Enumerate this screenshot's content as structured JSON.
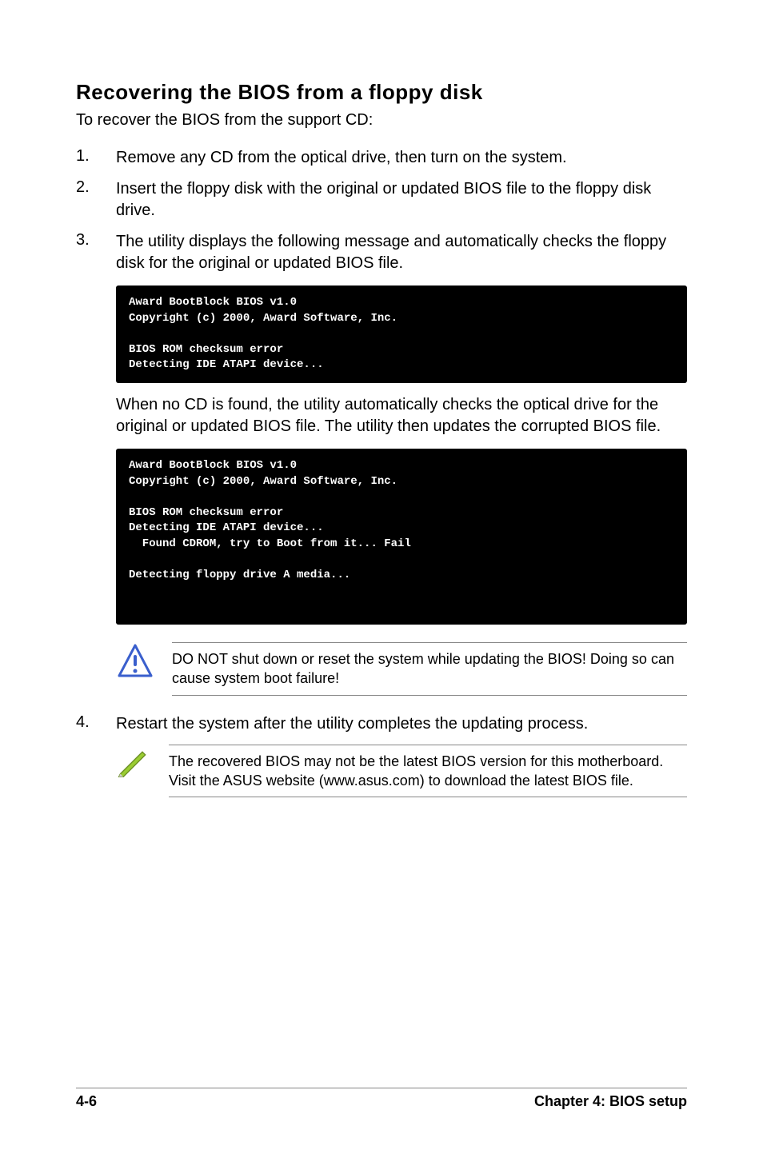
{
  "heading": "Recovering the BIOS from a floppy disk",
  "intro": "To recover the BIOS from the support CD:",
  "steps": {
    "s1": {
      "num": "1.",
      "text": "Remove any CD from the optical drive, then turn on the system."
    },
    "s2": {
      "num": "2.",
      "text": "Insert the floppy disk with the original or updated BIOS file to the floppy disk drive."
    },
    "s3": {
      "num": "3.",
      "text": "The utility displays the following message and automatically checks the floppy disk for the original or updated BIOS file."
    },
    "s4": {
      "num": "4.",
      "text": "Restart the system after the utility completes the updating process."
    }
  },
  "terminal1": "Award BootBlock BIOS v1.0\nCopyright (c) 2000, Award Software, Inc.\n\nBIOS ROM checksum error\nDetecting IDE ATAPI device...\n",
  "para_nocd": "When no CD is found, the utility automatically checks the optical drive for the original or updated BIOS file. The utility then updates the corrupted BIOS file.",
  "terminal2": "Award BootBlock BIOS v1.0\nCopyright (c) 2000, Award Software, Inc.\n\nBIOS ROM checksum error\nDetecting IDE ATAPI device...\n  Found CDROM, try to Boot from it... Fail\n\nDetecting floppy drive A media...\n\n\n",
  "warning_text": "DO NOT shut down or reset the system while updating the BIOS! Doing so can cause system boot failure!",
  "note_text": "The recovered BIOS may not be the latest BIOS version for this motherboard. Visit the ASUS website (www.asus.com) to download the latest BIOS file.",
  "footer": {
    "left": "4-6",
    "right": "Chapter 4: BIOS setup"
  }
}
